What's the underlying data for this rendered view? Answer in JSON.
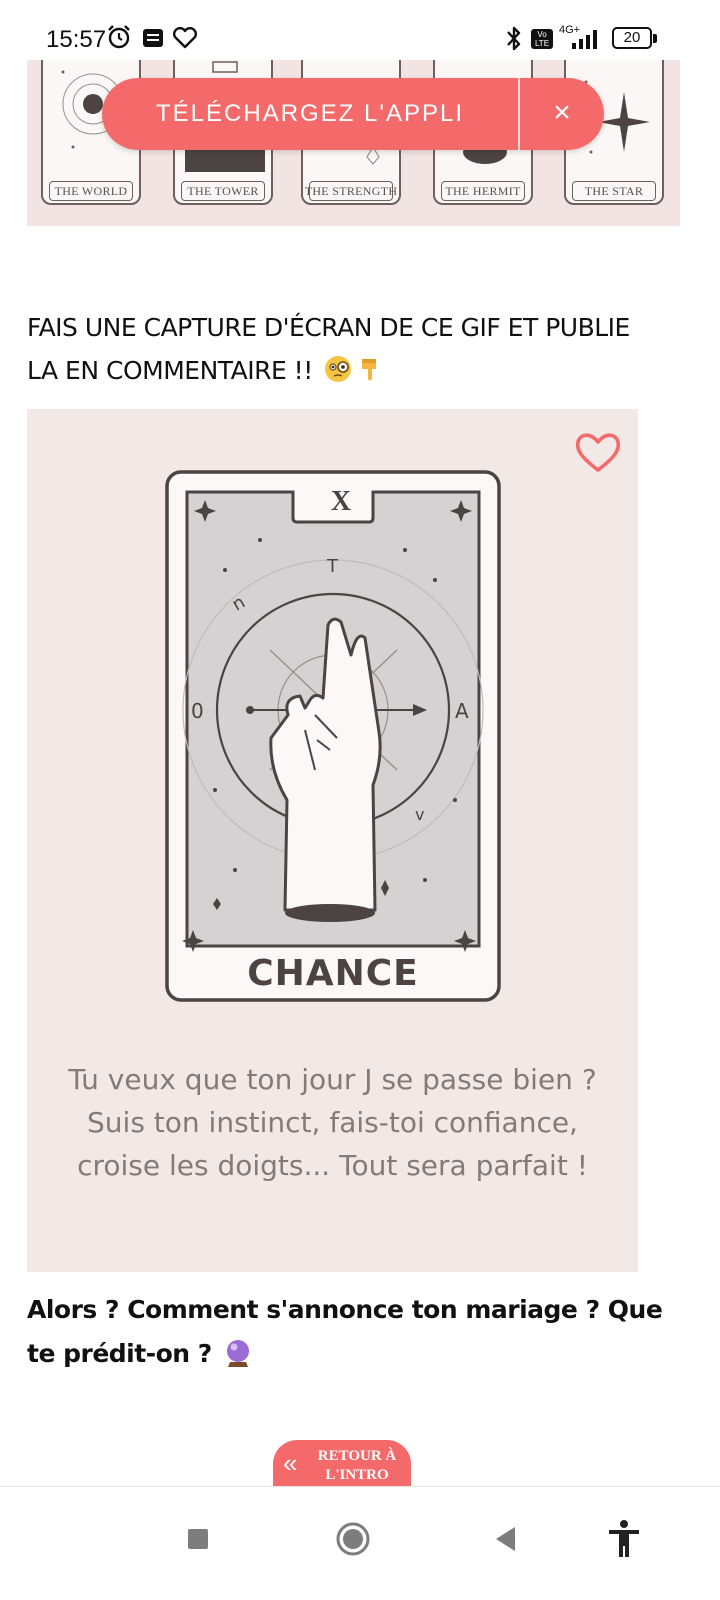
{
  "status_bar": {
    "time": "15:57",
    "network": "4G+",
    "volte": "Vo LTE",
    "battery": "20"
  },
  "tarot_strip": {
    "cards": [
      "THE WORLD",
      "THE TOWER",
      "THE STRENGTH",
      "THE HERMIT",
      "THE STAR"
    ]
  },
  "app_banner": {
    "label": "TÉLÉCHARGEZ L'APPLI",
    "close": "×",
    "color": "#f46a6a"
  },
  "post": {
    "heading": "FAIS UNE CAPTURE D'ÉCRAN DE CE GIF ET PUBLIE LA EN COMMENTAIRE !! ",
    "heading_emojis": [
      "face-with-monocle",
      "backhand-index-pointing-down"
    ]
  },
  "card": {
    "numeral": "X",
    "title": "CHANCE",
    "text": "Tu veux que ton jour J se passe bien ? Suis ton instinct, fais-toi confiance, croise les doigts... Tout sera parfait !",
    "heart_icon": "heart-outline-icon",
    "heart_color": "#f46a6a"
  },
  "question": {
    "text": "Alors ? Comment s'annonce ton mariage ? Que te prédit-on ? ",
    "emoji": "crystal-ball"
  },
  "back_button": {
    "label": "RETOUR À L'INTRO",
    "icon": "double-chevron-left-icon"
  },
  "nav_bar": {
    "buttons": [
      "recents-square-icon",
      "home-circle-icon",
      "back-triangle-icon",
      "accessibility-icon"
    ]
  }
}
